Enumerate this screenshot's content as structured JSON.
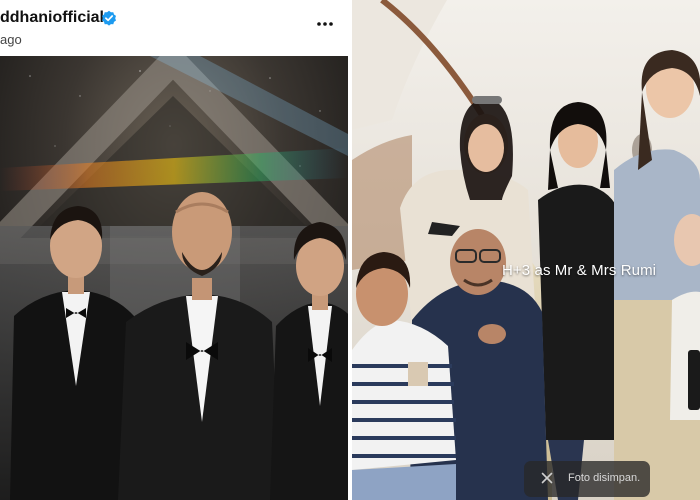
{
  "post": {
    "account_name": "ddhaniofficial",
    "time_ago": "ago",
    "verified_icon": "verified-badge-icon",
    "more_icon": "more-options-icon"
  },
  "story": {
    "caption": "H+3 as Mr & Mrs Rumi",
    "toast_text": "Foto disimpan.",
    "toast_icon": "close-x-icon"
  },
  "colors": {
    "verified_blue": "#1d9bf0",
    "toast_bg": "#2a2a2a"
  }
}
